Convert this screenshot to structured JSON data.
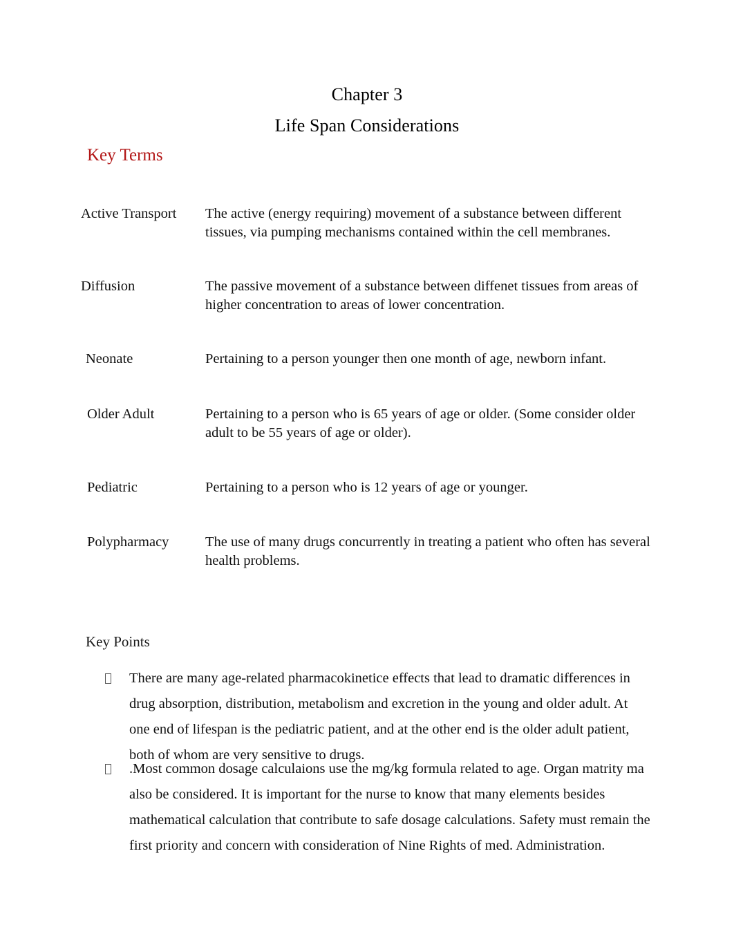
{
  "document": {
    "title_line_1": "Chapter 3",
    "title_line_2": "Life Span Considerations",
    "key_terms_heading": "Key Terms",
    "key_points_heading": "Key Points",
    "accent_color": "#b21515",
    "text_color": "#111111",
    "background_color": "#ffffff"
  },
  "key_terms": [
    {
      "term": "Active Transport",
      "definition": "The active (energy requiring) movement of a substance between different tissues, via pumping mechanisms contained within the cell membranes."
    },
    {
      "term": "Diffusion",
      "definition": "The passive movement of a substance between diffenet tissues from areas of higher concentration to areas of lower concentration."
    },
    {
      "term": "Neonate",
      "definition": "Pertaining to a person younger then one month of age, newborn infant."
    },
    {
      "term": "Older Adult",
      "definition": "Pertaining to a person who is 65 years of age or older. (Some consider older adult to be 55 years of age or older)."
    },
    {
      "term": "Pediatric",
      "definition": "Pertaining to a person who is 12 years of age or younger."
    },
    {
      "term": "Polypharmacy",
      "definition": "The use of many drugs concurrently in treating a patient who often has several health problems."
    }
  ],
  "key_points": [
    {
      "marker": "missing-glyph-box",
      "text": "There are many age-related pharmacokinetice effects that lead to dramatic differences in drug absorption, distribution, metabolism and excretion in the young and older adult. At one end of lifespan is the pediatric patient, and at the other end is the older adult patient, both of whom are very sensitive to drugs."
    },
    {
      "marker": "missing-glyph-box",
      "text": ".Most common dosage calculaions use the mg/kg formula related to age. Organ matrity ma also be considered.  It is important for the nurse to know that many elements besides mathematical calculation that contribute to safe dosage calculations. Safety must remain the first priority and concern with consideration of Nine Rights of med. Administration."
    }
  ]
}
